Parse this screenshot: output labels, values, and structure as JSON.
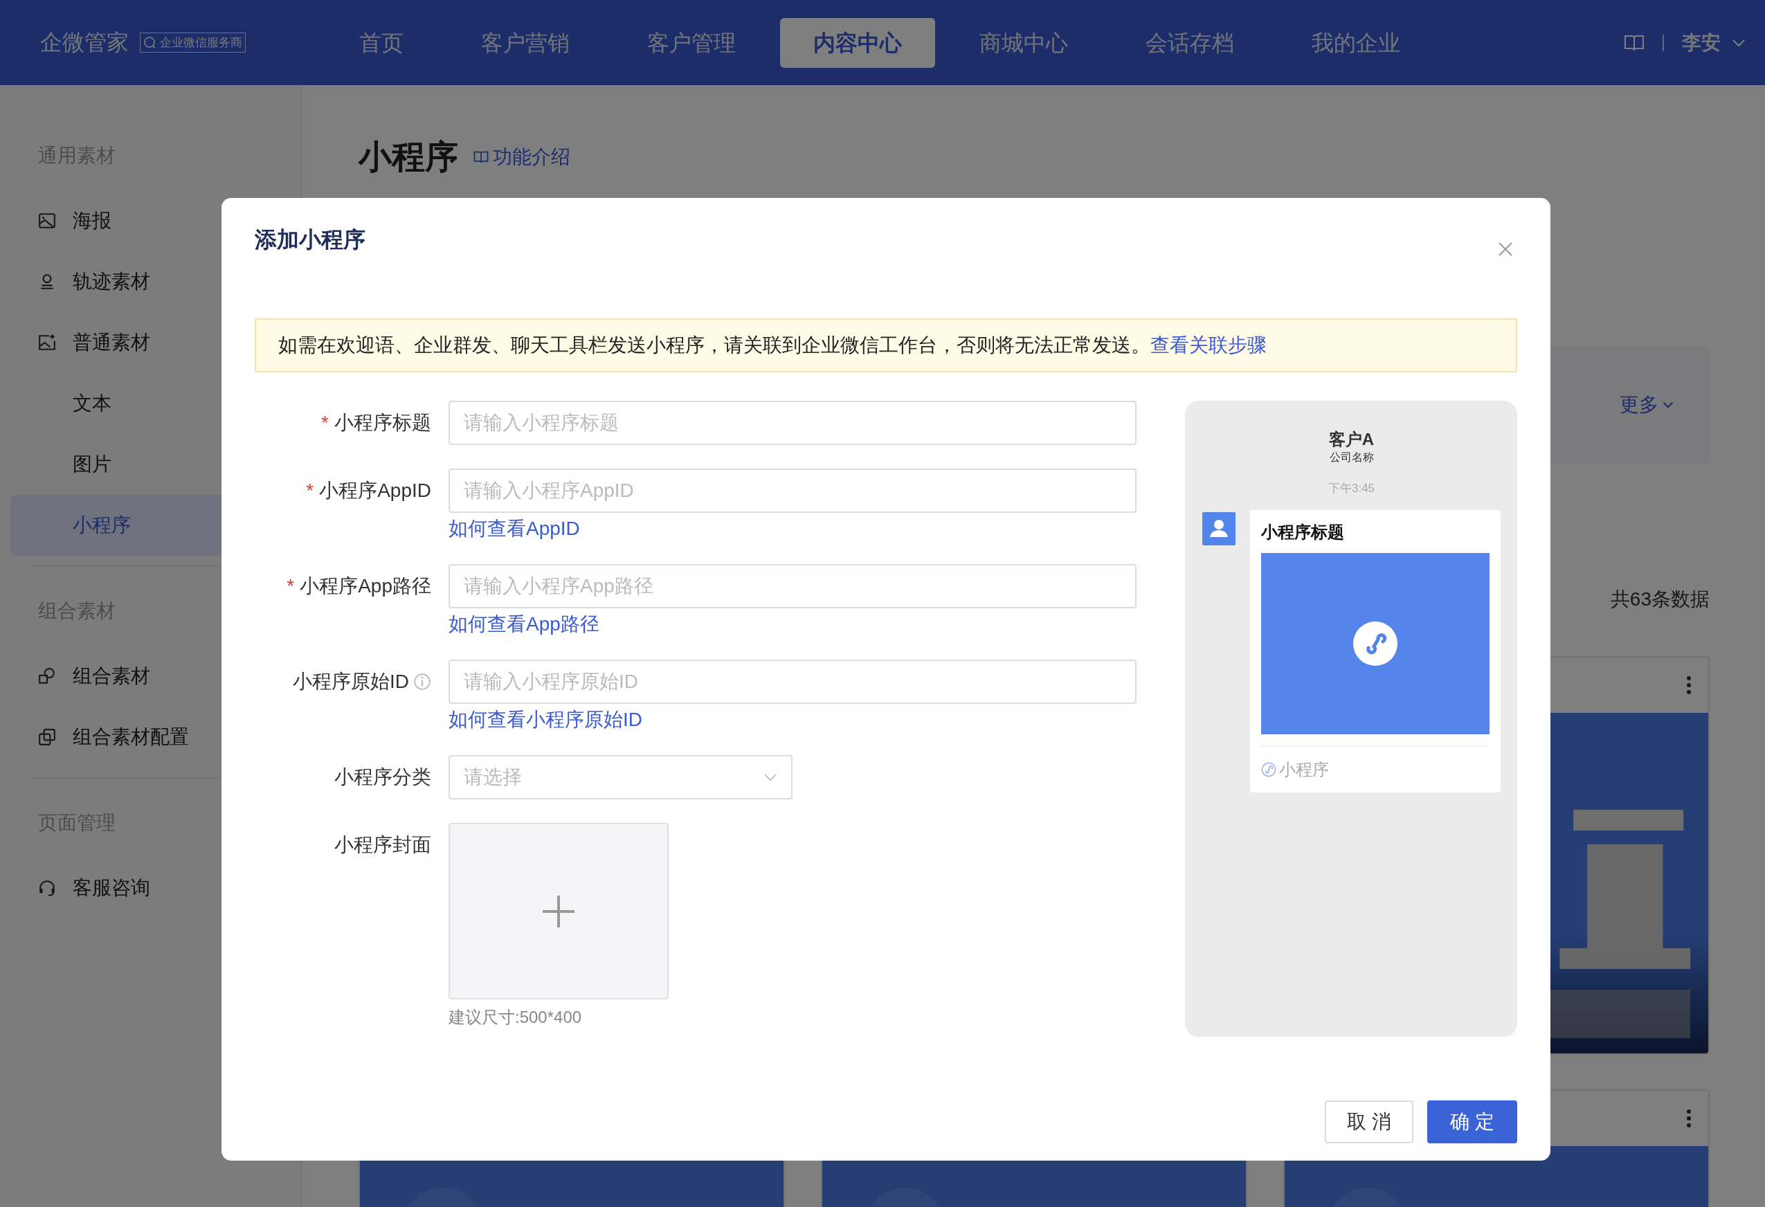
{
  "header": {
    "brand": "企微管家",
    "badge": "企业微信服务商",
    "user": "李安",
    "nav": [
      {
        "label": "首页",
        "selected": false
      },
      {
        "label": "客户营销",
        "selected": false
      },
      {
        "label": "客户管理",
        "selected": false
      },
      {
        "label": "内容中心",
        "selected": true
      },
      {
        "label": "商城中心",
        "selected": false
      },
      {
        "label": "会话存档",
        "selected": false
      },
      {
        "label": "我的企业",
        "selected": false
      }
    ]
  },
  "sidebar": {
    "groups": [
      {
        "title": "通用素材",
        "items": [
          {
            "label": "海报",
            "kind": "poster",
            "selected": false
          },
          {
            "label": "轨迹素材",
            "kind": "stamp",
            "selected": false
          },
          {
            "label": "普通素材",
            "kind": "image-plus",
            "selected": false
          },
          {
            "label": "文本",
            "kind": "plain",
            "selected": false
          },
          {
            "label": "图片",
            "kind": "plain",
            "selected": false
          },
          {
            "label": "小程序",
            "kind": "plain",
            "selected": true
          }
        ]
      },
      {
        "title": "组合素材",
        "items": [
          {
            "label": "组合素材",
            "kind": "combo",
            "selected": false
          },
          {
            "label": "组合素材配置",
            "kind": "copy",
            "selected": false
          }
        ]
      },
      {
        "title": "页面管理",
        "items": [
          {
            "label": "客服咨询",
            "kind": "headset",
            "selected": false
          }
        ]
      }
    ]
  },
  "page": {
    "title": "小程序",
    "intro_link": "功能介绍",
    "more_link": "更多",
    "total": "共63条数据",
    "cards": [
      {
        "kind": "picture",
        "menu": true
      },
      {
        "kind": "picture"
      },
      {
        "kind": "picture"
      },
      {
        "kind": "picture",
        "menu": true
      }
    ]
  },
  "dialog": {
    "title": "添加小程序",
    "notice": "如需在欢迎语、企业群发、聊天工具栏发送小程序，请关联到企业微信工作台，否则将无法正常发送。",
    "notice_link": "查看关联步骤",
    "fields": [
      {
        "kind": "input",
        "required_mark": "*",
        "label": "小程序标题",
        "placeholder": "请输入小程序标题"
      },
      {
        "kind": "input",
        "required_mark": "*",
        "label": "小程序AppID",
        "placeholder": "请输入小程序AppID",
        "help_link": "如何查看AppID"
      },
      {
        "kind": "input",
        "required_mark": "*",
        "label": "小程序App路径",
        "placeholder": "请输入小程序App路径",
        "help_link": "如何查看App路径"
      },
      {
        "kind": "input",
        "label": "小程序原始ID",
        "info": true,
        "placeholder": "请输入小程序原始ID",
        "help_link": "如何查看小程序原始ID"
      },
      {
        "kind": "select",
        "label": "小程序分类",
        "placeholder": "请选择"
      },
      {
        "kind": "upload",
        "label": "小程序封面",
        "hint": "建议尺寸:500*400"
      }
    ],
    "preview": {
      "contact": "客户A",
      "company": "公司名称",
      "time": "下午3:45",
      "card_title": "小程序标题",
      "card_source": "小程序"
    },
    "buttons": [
      {
        "label": "取 消",
        "kind": "default"
      },
      {
        "label": "确 定",
        "kind": "primary"
      }
    ]
  }
}
